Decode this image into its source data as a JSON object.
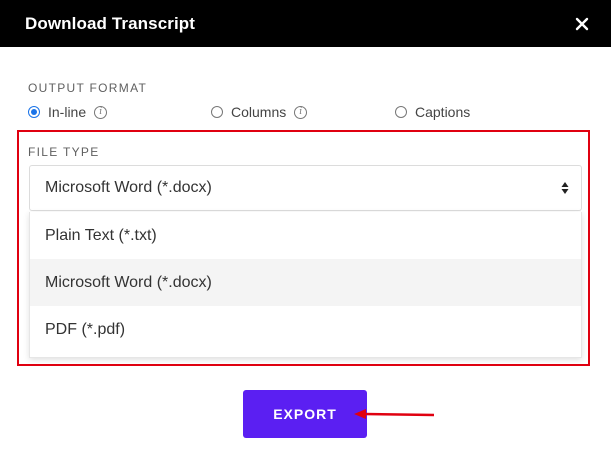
{
  "dialog": {
    "title": "Download Transcript",
    "close_icon": "close-icon"
  },
  "output_format": {
    "label": "OUTPUT FORMAT",
    "options": [
      {
        "label": "In-line",
        "checked": true,
        "info": true
      },
      {
        "label": "Columns",
        "checked": false,
        "info": true
      },
      {
        "label": "Captions",
        "checked": false,
        "info": false
      }
    ],
    "info_glyph": "i"
  },
  "file_type": {
    "label": "FILE TYPE",
    "selected": "Microsoft Word (*.docx)",
    "options": [
      {
        "label": "Plain Text (*.txt)",
        "selected": false
      },
      {
        "label": "Microsoft Word (*.docx)",
        "selected": true
      },
      {
        "label": "PDF (*.pdf)",
        "selected": false
      }
    ]
  },
  "actions": {
    "export_label": "EXPORT"
  },
  "colors": {
    "header_bg": "#000000",
    "accent": "#5b1ff2",
    "radio_checked": "#1a73e8",
    "annotation": "#e00010"
  }
}
